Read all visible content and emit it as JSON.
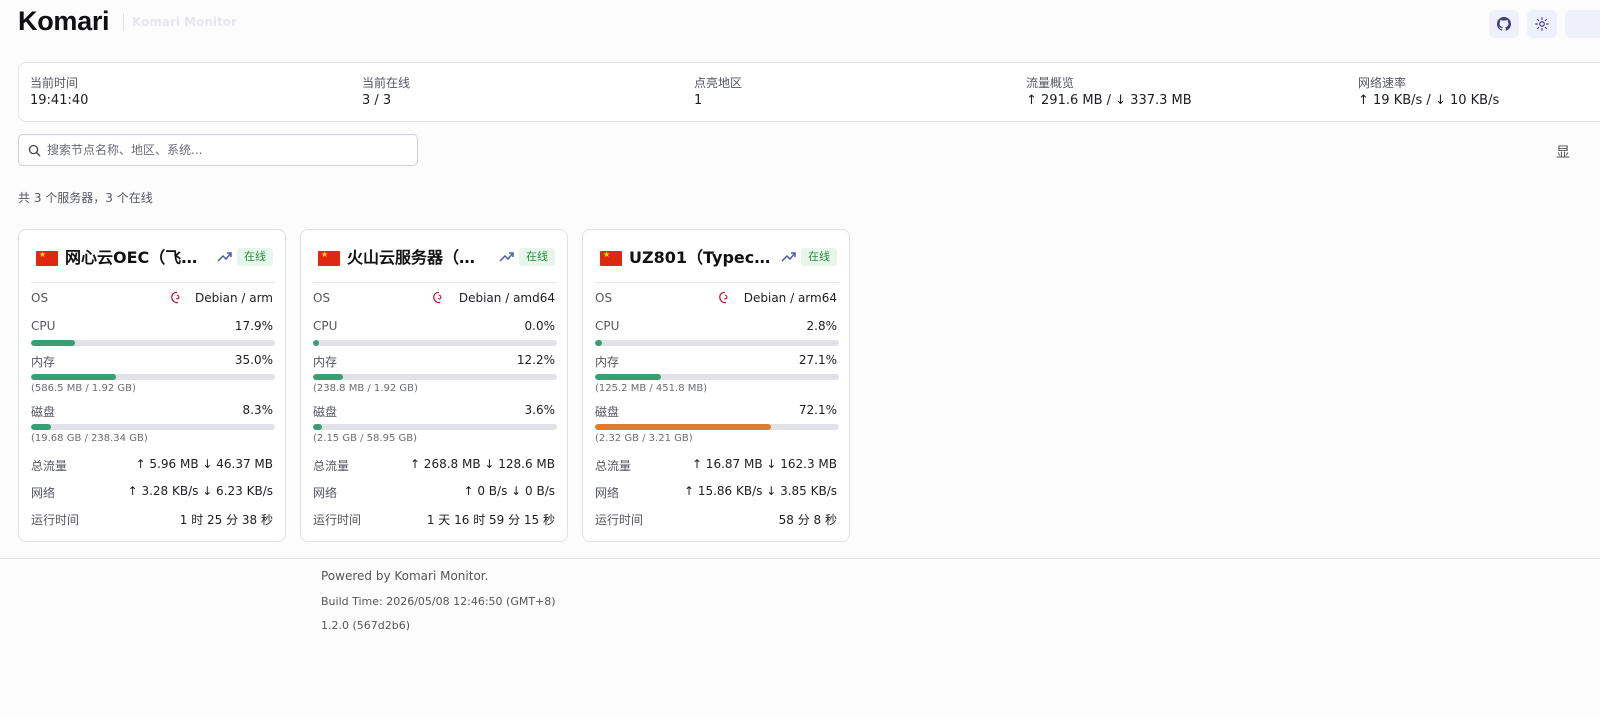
{
  "header": {
    "brand": "Komari",
    "subtitle": "Komari Monitor"
  },
  "stats": [
    {
      "label": "当前时间",
      "value": "19:41:40"
    },
    {
      "label": "当前在线",
      "value": "3 / 3"
    },
    {
      "label": "点亮地区",
      "value": "1"
    },
    {
      "label": "流量概览",
      "value": "↑ 291.6 MB / ↓ 337.3 MB"
    },
    {
      "label": "网络速率",
      "value": "↑ 19 KB/s / ↓ 10 KB/s"
    }
  ],
  "search": {
    "placeholder": "搜索节点名称、地区、系统..."
  },
  "view_toggle": "显",
  "summary": "共 3 个服务器，3 个在线",
  "labels": {
    "os": "OS",
    "cpu": "CPU",
    "mem": "内存",
    "disk": "磁盘",
    "traffic": "总流量",
    "net": "网络",
    "uptime": "运行时间"
  },
  "servers": [
    {
      "name": "网心云OEC（飞…",
      "status": "在线",
      "flag": "cn-flag",
      "os": "Debian / arm",
      "cpu": "17.9%",
      "cpu_pct": 17.9,
      "mem": "35.0%",
      "mem_pct": 35.0,
      "mem_detail": "(586.5 MB / 1.92 GB)",
      "disk": "8.3%",
      "disk_pct": 8.3,
      "disk_detail": "(19.68 GB / 238.34 GB)",
      "traffic": "↑ 5.96 MB ↓ 46.37 MB",
      "net": "↑ 3.28 KB/s ↓ 6.23 KB/s",
      "uptime": "1 时 25 分 38 秒"
    },
    {
      "name": "火山云服务器（…",
      "status": "在线",
      "flag": "cn-flag",
      "os": "Debian / amd64",
      "cpu": "0.0%",
      "cpu_pct": 0.0,
      "mem": "12.2%",
      "mem_pct": 12.2,
      "mem_detail": "(238.8 MB / 1.92 GB)",
      "disk": "3.6%",
      "disk_pct": 3.6,
      "disk_detail": "(2.15 GB / 58.95 GB)",
      "traffic": "↑ 268.8 MB ↓ 128.6 MB",
      "net": "↑ 0 B/s ↓ 0 B/s",
      "uptime": "1 天 16 时 59 分 15 秒"
    },
    {
      "name": "UZ801（Typech…",
      "status": "在线",
      "flag": "cn-flag",
      "os": "Debian / arm64",
      "cpu": "2.8%",
      "cpu_pct": 2.8,
      "mem": "27.1%",
      "mem_pct": 27.1,
      "mem_detail": "(125.2 MB / 451.8 MB)",
      "disk": "72.1%",
      "disk_pct": 72.1,
      "disk_detail": "(2.32 GB / 3.21 GB)",
      "traffic": "↑ 16.87 MB ↓ 162.3 MB",
      "net": "↑ 15.86 KB/s ↓ 3.85 KB/s",
      "uptime": "58 分 8 秒"
    }
  ],
  "colors": {
    "bar_normal": "#3a9e73",
    "bar_warn": "#e07b2d",
    "badge_bg": "#e7f6ea",
    "badge_text": "#2b8a3e"
  },
  "footer": {
    "powered": "Powered by Komari Monitor.",
    "build": "Build Time: 2026/05/08 12:46:50 (GMT+8)",
    "version": "1.2.0 (567d2b6)"
  }
}
